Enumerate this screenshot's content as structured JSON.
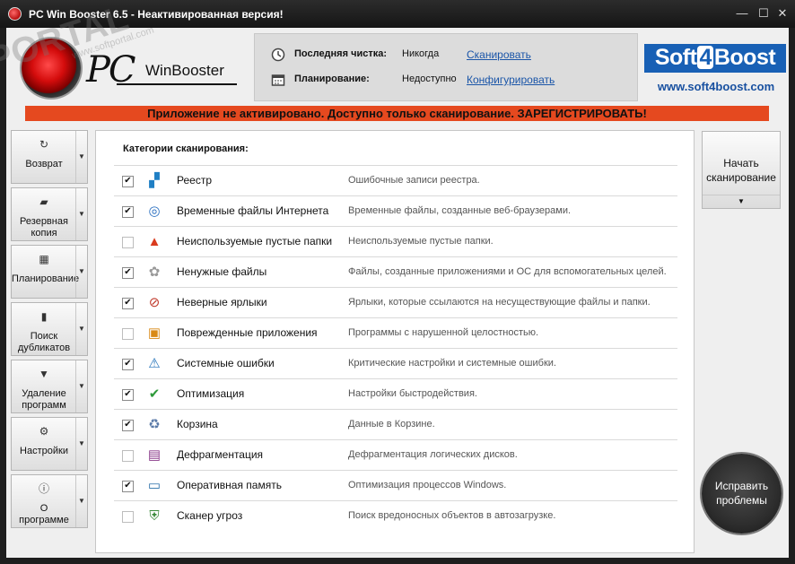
{
  "window": {
    "title": "PC Win Booster 6.5 - Неактивированная версия!",
    "minimize_glyph": "—",
    "maximize_glyph": "☐",
    "close_glyph": "✕"
  },
  "logo": {
    "pc": "PC",
    "winbooster": "WinBooster",
    "watermark": "PORTAL",
    "watermark_url": "www.softportal.com",
    "tm": "TM"
  },
  "status": {
    "last_scan": {
      "label": "Последняя чистка:",
      "value": "Никогда",
      "link": "Сканировать",
      "icon": "clock-icon"
    },
    "schedule": {
      "label": "Планирование:",
      "value": "Недоступно",
      "link": "Конфигурировать",
      "icon": "calendar-icon"
    }
  },
  "vendor": {
    "brand_pre": "Soft",
    "brand_four": "4",
    "brand_post": "Boost",
    "url": "www.soft4boost.com",
    "color": "#1860b5"
  },
  "banner": {
    "text": "Приложение не активировано. Доступно только сканирование. ЗАРЕГИСТРИРОВАТЬ!",
    "color": "#e5491f"
  },
  "sidebar": {
    "items": [
      {
        "label": "Возврат",
        "icon": "restore-icon",
        "glyph": "↻"
      },
      {
        "label": "Резервная копия",
        "icon": "backup-icon",
        "glyph": "▰"
      },
      {
        "label": "Планирование",
        "icon": "calendar-icon",
        "glyph": "▦"
      },
      {
        "label": "Поиск дубликатов",
        "icon": "duplicate-icon",
        "glyph": "▮"
      },
      {
        "label": "Удаление программ",
        "icon": "trash-icon",
        "glyph": "▼"
      },
      {
        "label": "Настройки",
        "icon": "settings-icon",
        "glyph": "⚙"
      },
      {
        "label": "О программе",
        "icon": "info-icon",
        "glyph": "ⓘ"
      }
    ],
    "arrow": "▼"
  },
  "scan": {
    "header": "Категории сканирования:",
    "categories": [
      {
        "name": "Реестр",
        "desc": "Ошибочные записи реестра.",
        "checked": true,
        "icon": "registry-icon",
        "glyph": "▞"
      },
      {
        "name": "Временные файлы Интернета",
        "desc": "Временные файлы, созданные веб-браузерами.",
        "checked": true,
        "icon": "internet-icon",
        "glyph": "◎"
      },
      {
        "name": "Неиспользуемые пустые папки",
        "desc": "Неиспользуемые пустые папки.",
        "checked": false,
        "icon": "folder-warning-icon",
        "glyph": "▲"
      },
      {
        "name": "Ненужные файлы",
        "desc": "Файлы, созданные приложениями и ОС для вспомогательных целей.",
        "checked": true,
        "icon": "junk-files-icon",
        "glyph": "✿"
      },
      {
        "name": "Неверные ярлыки",
        "desc": "Ярлыки, которые ссылаются на несуществующие файлы и папки.",
        "checked": true,
        "icon": "broken-shortcut-icon",
        "glyph": "⊘"
      },
      {
        "name": "Поврежденные приложения",
        "desc": "Программы с нарушенной целостностью.",
        "checked": false,
        "icon": "damaged-app-icon",
        "glyph": "▣"
      },
      {
        "name": "Системные ошибки",
        "desc": "Критические настройки и системные ошибки.",
        "checked": true,
        "icon": "system-error-icon",
        "glyph": "⚠"
      },
      {
        "name": "Оптимизация",
        "desc": "Настройки быстродействия.",
        "checked": true,
        "icon": "optimization-icon",
        "glyph": "✔"
      },
      {
        "name": "Корзина",
        "desc": "Данные в Корзине.",
        "checked": true,
        "icon": "recycle-bin-icon",
        "glyph": "♻"
      },
      {
        "name": "Дефрагментация",
        "desc": "Дефрагментация логических дисков.",
        "checked": false,
        "icon": "defrag-icon",
        "glyph": "▤"
      },
      {
        "name": "Оперативная память",
        "desc": "Оптимизация процессов Windows.",
        "checked": true,
        "icon": "memory-icon",
        "glyph": "▭"
      },
      {
        "name": "Сканер угроз",
        "desc": "Поиск вредоносных объектов в автозагрузке.",
        "checked": false,
        "icon": "shield-icon",
        "glyph": "⛨"
      }
    ],
    "check_glyph": "✔"
  },
  "actions": {
    "start_label_1": "Начать",
    "start_label_2": "сканирование",
    "fix_label_1": "Исправить",
    "fix_label_2": "проблемы"
  }
}
